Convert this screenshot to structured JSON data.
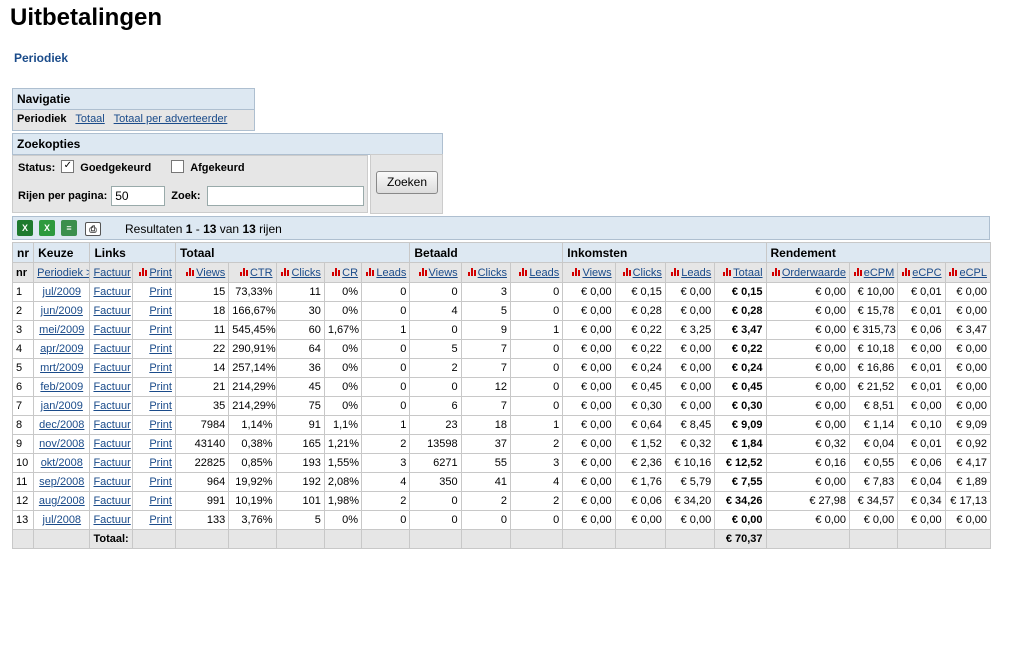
{
  "page": {
    "title": "Uitbetalingen",
    "sublink": "Periodiek"
  },
  "nav": {
    "title": "Navigatie",
    "current": "Periodiek",
    "links": [
      "Totaal",
      "Totaal per adverteerder"
    ]
  },
  "filters": {
    "title": "Zoekopties",
    "status_label": "Status:",
    "approved_label": "Goedgekeurd",
    "approved_checked": true,
    "rejected_label": "Afgekeurd",
    "rejected_checked": false,
    "rows_label": "Rijen per pagina:",
    "rows_value": "50",
    "search_label": "Zoek:",
    "search_value": "",
    "search_button": "Zoeken"
  },
  "toolbar": {
    "results_prefix": "Resultaten ",
    "results_from": "1",
    "results_dash": " - ",
    "results_to": "13",
    "results_mid": " van ",
    "results_total": "13",
    "results_suffix": " rijen"
  },
  "table": {
    "groups": [
      "nr",
      "Keuze",
      "Links",
      "Totaal",
      "Betaald",
      "Inkomsten",
      "Rendement"
    ],
    "headers": [
      "nr",
      "Periodiek >",
      "Factuur",
      "Print",
      "Views",
      "CTR",
      "Clicks",
      "CR",
      "Leads",
      "Views",
      "Clicks",
      "Leads",
      "Views",
      "Clicks",
      "Leads",
      "Totaal",
      "Orderwaarde",
      "eCPM",
      "eCPC",
      "eCPL"
    ],
    "rows": [
      [
        "1",
        "jul/2009",
        "Factuur",
        "Print",
        "15",
        "73,33%",
        "11",
        "0%",
        "0",
        "0",
        "3",
        "0",
        "€ 0,00",
        "€ 0,15",
        "€ 0,00",
        "€ 0,15",
        "€ 0,00",
        "€ 10,00",
        "€ 0,01",
        "€ 0,00"
      ],
      [
        "2",
        "jun/2009",
        "Factuur",
        "Print",
        "18",
        "166,67%",
        "30",
        "0%",
        "0",
        "4",
        "5",
        "0",
        "€ 0,00",
        "€ 0,28",
        "€ 0,00",
        "€ 0,28",
        "€ 0,00",
        "€ 15,78",
        "€ 0,01",
        "€ 0,00"
      ],
      [
        "3",
        "mei/2009",
        "Factuur",
        "Print",
        "11",
        "545,45%",
        "60",
        "1,67%",
        "1",
        "0",
        "9",
        "1",
        "€ 0,00",
        "€ 0,22",
        "€ 3,25",
        "€ 3,47",
        "€ 0,00",
        "€ 315,73",
        "€ 0,06",
        "€ 3,47"
      ],
      [
        "4",
        "apr/2009",
        "Factuur",
        "Print",
        "22",
        "290,91%",
        "64",
        "0%",
        "0",
        "5",
        "7",
        "0",
        "€ 0,00",
        "€ 0,22",
        "€ 0,00",
        "€ 0,22",
        "€ 0,00",
        "€ 10,18",
        "€ 0,00",
        "€ 0,00"
      ],
      [
        "5",
        "mrt/2009",
        "Factuur",
        "Print",
        "14",
        "257,14%",
        "36",
        "0%",
        "0",
        "2",
        "7",
        "0",
        "€ 0,00",
        "€ 0,24",
        "€ 0,00",
        "€ 0,24",
        "€ 0,00",
        "€ 16,86",
        "€ 0,01",
        "€ 0,00"
      ],
      [
        "6",
        "feb/2009",
        "Factuur",
        "Print",
        "21",
        "214,29%",
        "45",
        "0%",
        "0",
        "0",
        "12",
        "0",
        "€ 0,00",
        "€ 0,45",
        "€ 0,00",
        "€ 0,45",
        "€ 0,00",
        "€ 21,52",
        "€ 0,01",
        "€ 0,00"
      ],
      [
        "7",
        "jan/2009",
        "Factuur",
        "Print",
        "35",
        "214,29%",
        "75",
        "0%",
        "0",
        "6",
        "7",
        "0",
        "€ 0,00",
        "€ 0,30",
        "€ 0,00",
        "€ 0,30",
        "€ 0,00",
        "€ 8,51",
        "€ 0,00",
        "€ 0,00"
      ],
      [
        "8",
        "dec/2008",
        "Factuur",
        "Print",
        "7984",
        "1,14%",
        "91",
        "1,1%",
        "1",
        "23",
        "18",
        "1",
        "€ 0,00",
        "€ 0,64",
        "€ 8,45",
        "€ 9,09",
        "€ 0,00",
        "€ 1,14",
        "€ 0,10",
        "€ 9,09"
      ],
      [
        "9",
        "nov/2008",
        "Factuur",
        "Print",
        "43140",
        "0,38%",
        "165",
        "1,21%",
        "2",
        "13598",
        "37",
        "2",
        "€ 0,00",
        "€ 1,52",
        "€ 0,32",
        "€ 1,84",
        "€ 0,32",
        "€ 0,04",
        "€ 0,01",
        "€ 0,92"
      ],
      [
        "10",
        "okt/2008",
        "Factuur",
        "Print",
        "22825",
        "0,85%",
        "193",
        "1,55%",
        "3",
        "6271",
        "55",
        "3",
        "€ 0,00",
        "€ 2,36",
        "€ 10,16",
        "€ 12,52",
        "€ 0,16",
        "€ 0,55",
        "€ 0,06",
        "€ 4,17"
      ],
      [
        "11",
        "sep/2008",
        "Factuur",
        "Print",
        "964",
        "19,92%",
        "192",
        "2,08%",
        "4",
        "350",
        "41",
        "4",
        "€ 0,00",
        "€ 1,76",
        "€ 5,79",
        "€ 7,55",
        "€ 0,00",
        "€ 7,83",
        "€ 0,04",
        "€ 1,89"
      ],
      [
        "12",
        "aug/2008",
        "Factuur",
        "Print",
        "991",
        "10,19%",
        "101",
        "1,98%",
        "2",
        "0",
        "2",
        "2",
        "€ 0,00",
        "€ 0,06",
        "€ 34,20",
        "€ 34,26",
        "€ 27,98",
        "€ 34,57",
        "€ 0,34",
        "€ 17,13"
      ],
      [
        "13",
        "jul/2008",
        "Factuur",
        "Print",
        "133",
        "3,76%",
        "5",
        "0%",
        "0",
        "0",
        "0",
        "0",
        "€ 0,00",
        "€ 0,00",
        "€ 0,00",
        "€ 0,00",
        "€ 0,00",
        "€ 0,00",
        "€ 0,00",
        "€ 0,00"
      ]
    ],
    "total_label": "Totaal:",
    "total_value": "€ 70,37"
  }
}
